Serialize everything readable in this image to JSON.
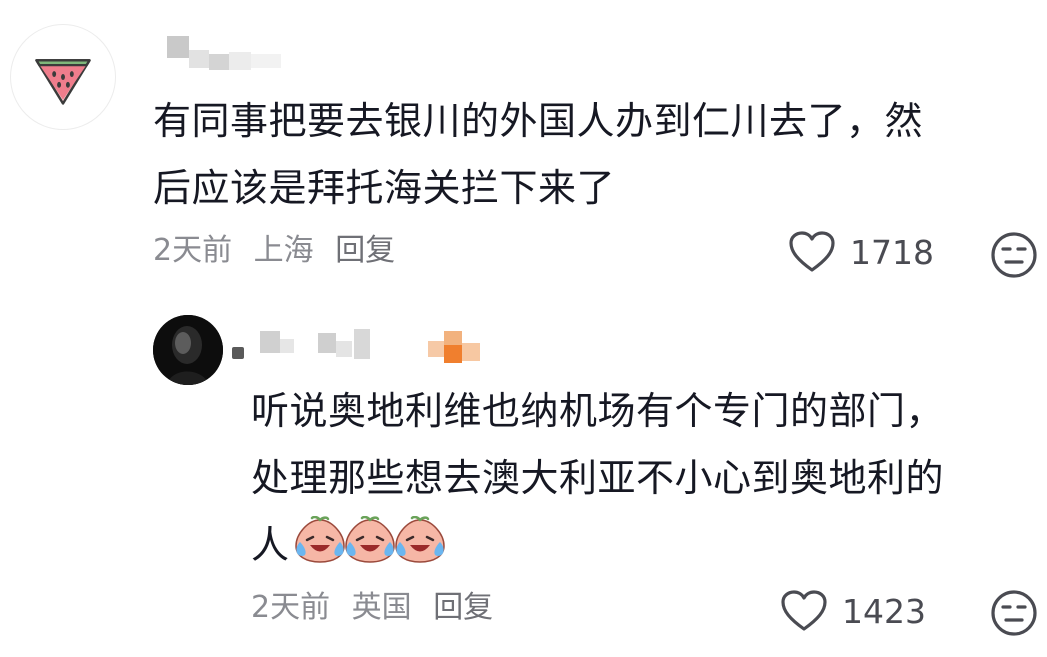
{
  "comments": [
    {
      "avatar_icon": "watermelon-icon",
      "text_lines": [
        "有同事把要去银川的外国人办到仁川去了，然",
        "后应该是拜托海关拦下来了"
      ],
      "time": "2天前",
      "location": "上海",
      "reply_label": "回复",
      "likes": "1718",
      "dislike_icon": "neutral-face-icon"
    },
    {
      "avatar_icon": "dark-portrait-avatar",
      "text_lines": [
        "听说奥地利维也纳机场有个专门的部门，",
        "处理那些想去澳大利亚不小心到奥地利的",
        "人"
      ],
      "emoji": [
        "crying-laughing-peach-emoji",
        "crying-laughing-peach-emoji",
        "crying-laughing-peach-emoji"
      ],
      "time": "2天前",
      "location": "英国",
      "reply_label": "回复",
      "likes": "1423",
      "dislike_icon": "neutral-face-icon"
    }
  ],
  "colors": {
    "text": "#161823",
    "meta": "#8a8b91",
    "icon": "#4a4b52",
    "watermelon_rind": "#7fb77a",
    "watermelon_flesh": "#ef7d8c"
  }
}
